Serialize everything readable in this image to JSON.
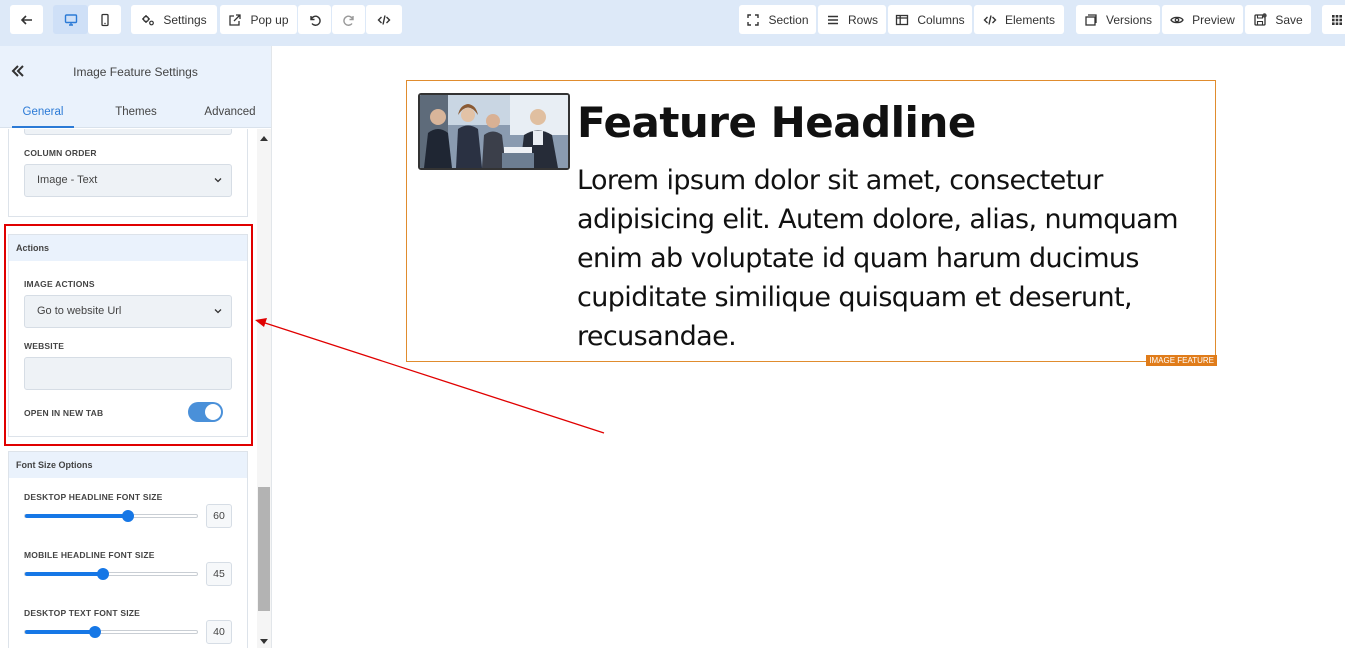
{
  "toolbar": {
    "settings_label": "Settings",
    "popup_label": "Pop up",
    "section_label": "Section",
    "rows_label": "Rows",
    "columns_label": "Columns",
    "elements_label": "Elements",
    "versions_label": "Versions",
    "preview_label": "Preview",
    "save_label": "Save"
  },
  "panel": {
    "title": "Image Feature Settings",
    "tabs": [
      "General",
      "Themes",
      "Advanced"
    ],
    "active_tab": "General",
    "column_order": {
      "label": "COLUMN ORDER",
      "value": "Image - Text"
    },
    "actions": {
      "title": "Actions",
      "image_actions_label": "IMAGE ACTIONS",
      "image_actions_value": "Go to website Url",
      "website_label": "WEBSITE",
      "website_value": "",
      "open_new_tab_label": "OPEN IN NEW TAB",
      "open_new_tab_on": true
    },
    "font_size": {
      "title": "Font Size Options",
      "items": [
        {
          "label": "DESKTOP HEADLINE FONT SIZE",
          "value": "60",
          "fraction": 0.59
        },
        {
          "label": "MOBILE HEADLINE FONT SIZE",
          "value": "45",
          "fraction": 0.45
        },
        {
          "label": "DESKTOP TEXT FONT SIZE",
          "value": "40",
          "fraction": 0.4
        }
      ]
    }
  },
  "canvas": {
    "headline": "Feature Headline",
    "body": "Lorem ipsum dolor sit amet, consectetur adipisicing elit. Autem dolore, alias, numquam enim ab voluptate id quam harum ducimus cupiditate similique quisquam et deserunt, recusandae.",
    "tag": "IMAGE FEATURE"
  },
  "colors": {
    "accent": "#1677e6",
    "highlight": "#e00000",
    "element_border": "#e08c2e"
  }
}
